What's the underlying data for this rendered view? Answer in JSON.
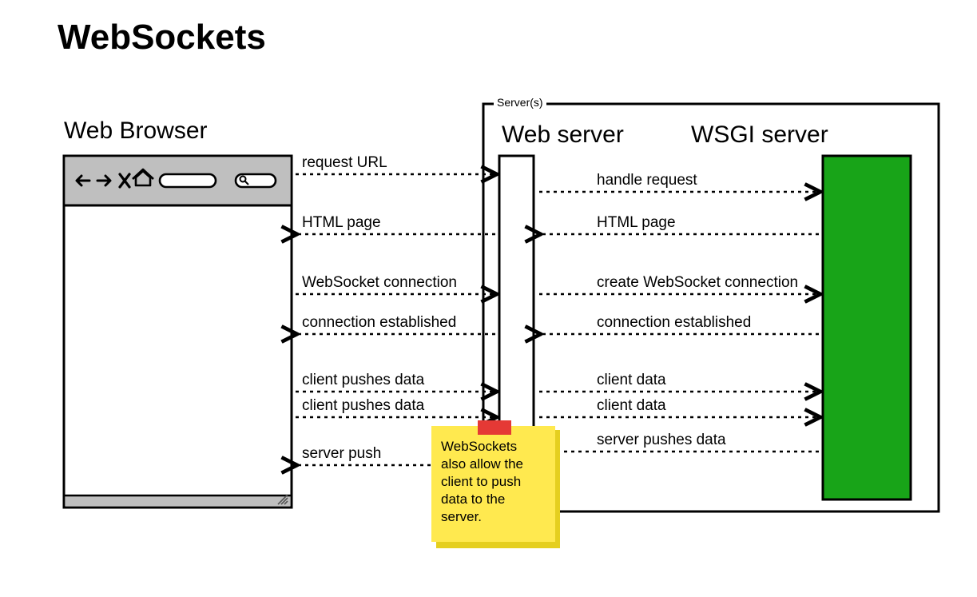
{
  "title": "WebSockets",
  "headings": {
    "browser": "Web Browser",
    "webserver": "Web server",
    "wsgi": "WSGI server",
    "servers_box": "Server(s)"
  },
  "sticky_note": {
    "l1": "WebSockets",
    "l2": "also allow the",
    "l3": "client to push",
    "l4": "data to the",
    "l5": "server."
  },
  "left_arrows": {
    "a1": "request URL",
    "a2": "HTML page",
    "a3": "WebSocket connection",
    "a4": "connection established",
    "a5": "client pushes data",
    "a6": "client pushes data",
    "a7": "server push"
  },
  "right_arrows": {
    "a1": "handle request",
    "a2": "HTML page",
    "a3": "create WebSocket connection",
    "a4": "connection established",
    "a5": "client data",
    "a6": "client data",
    "a7": "server pushes data"
  },
  "colors": {
    "wsgi_fill": "#18a418",
    "browser_chrome": "#bfbfbf",
    "sticky": "#ffe94f",
    "sticky_shadow": "#e5cf1f",
    "tape": "#e53935"
  }
}
